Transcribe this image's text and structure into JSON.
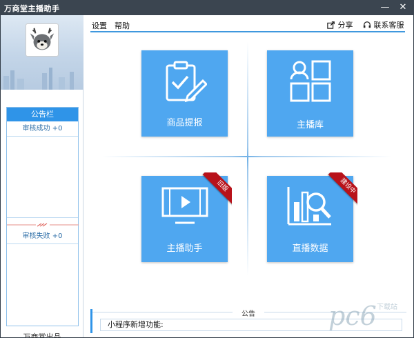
{
  "window": {
    "title": "万商堂主播助手",
    "minimize_glyph": "—",
    "close_glyph": "✕"
  },
  "sidebar": {
    "notice_title": "公告栏",
    "approved_label": "审核成功 +0",
    "rejected_label": "审核失败 +0",
    "credit": "万商堂出品"
  },
  "menu": {
    "settings": "设置",
    "help": "帮助",
    "share": "分享",
    "support": "联系客服"
  },
  "tiles": [
    {
      "label": "商品提报",
      "icon": "clipboard-edit-icon"
    },
    {
      "label": "主播库",
      "icon": "person-grid-icon"
    },
    {
      "label": "主播助手",
      "icon": "video-screen-icon",
      "ribbon": "旧版"
    },
    {
      "label": "直播数据",
      "icon": "chart-magnifier-icon",
      "ribbon": "建设中"
    }
  ],
  "announcement": {
    "heading": "公告",
    "message": "小程序新增功能:"
  },
  "watermark": {
    "main": "pc6",
    "sub": "下载站"
  },
  "colors": {
    "tile": "#4fa7f0",
    "accent": "#2f94e8",
    "ribbon": "#b8121a",
    "titlebar": "#3b4550"
  }
}
